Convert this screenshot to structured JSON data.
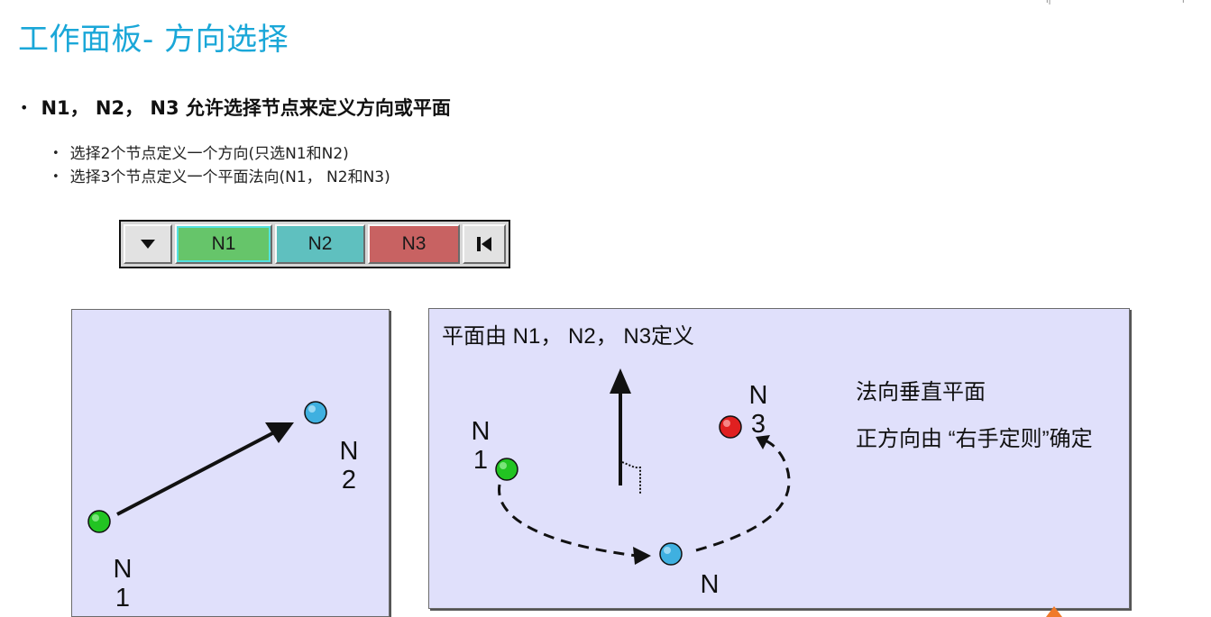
{
  "slide": {
    "title": "工作面板- 方向选择",
    "main_bullet": "N1， N2， N3 允许选择节点来定义方向或平面",
    "sub_bullets": [
      "选择2个节点定义一个方向(只选N1和N2)",
      "选择3个节点定义一个平面法向(N1， N2和N3)"
    ]
  },
  "toolbar": {
    "dropdown_icon": "triangle-down-icon",
    "n1_label": "N1",
    "n2_label": "N2",
    "n3_label": "N3",
    "first_icon": "skip-first-icon",
    "colors": {
      "n1": "#66c56a",
      "n2": "#5fc0bf",
      "n3": "#c86262",
      "n1_outline": "#53e0e0"
    }
  },
  "left_panel": {
    "node1_label": "N\n1",
    "node2_label": "N\n2",
    "colors": {
      "node1": "#22c422",
      "node2": "#3fb0e0",
      "background": "#e0e0fb"
    }
  },
  "right_panel": {
    "plane_title": "平面由 N1， N2， N3定义",
    "normal_note": "法向垂直平面",
    "direction_note": "正方向由 “右手定则”确定",
    "node1_label": "N\n1",
    "node2_label": "N",
    "node3_label": "N\n3",
    "colors": {
      "node1": "#22c422",
      "node2": "#3fb0e0",
      "node3": "#e02020",
      "background": "#e0e0fb"
    }
  }
}
